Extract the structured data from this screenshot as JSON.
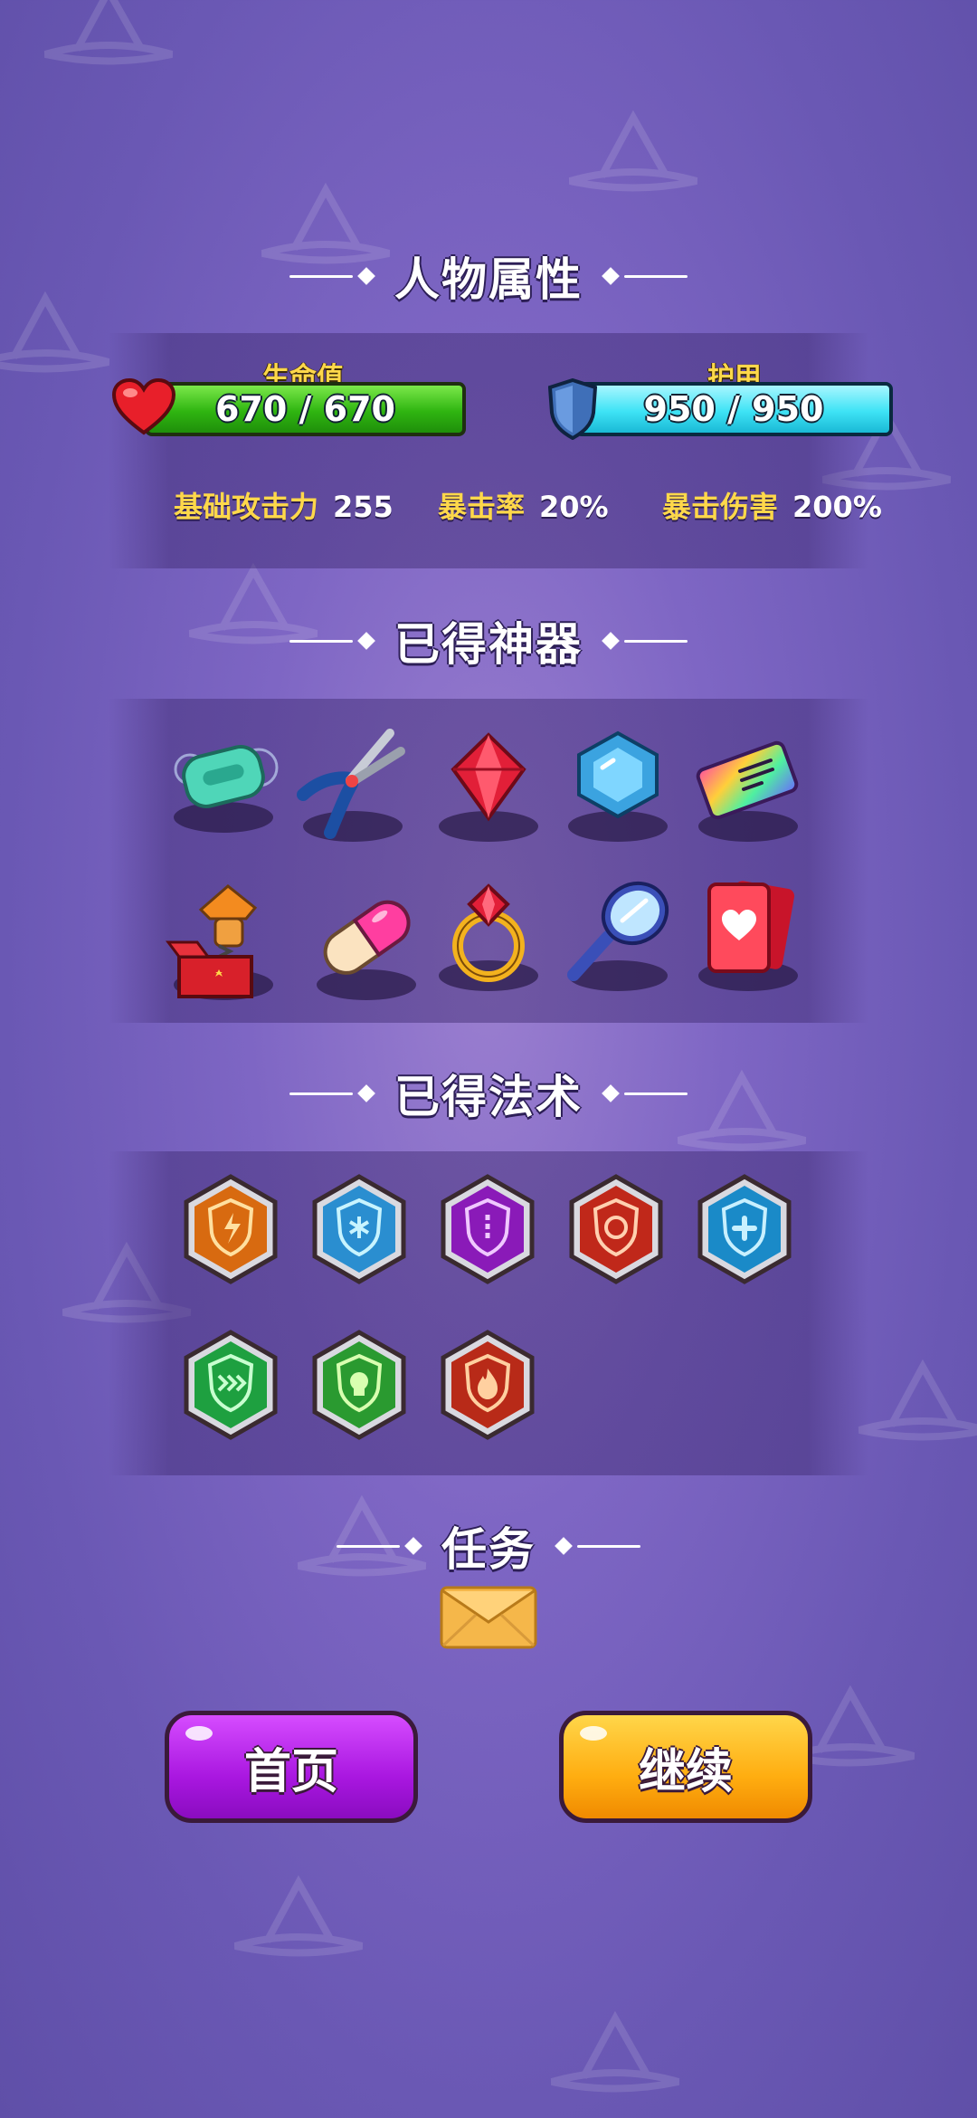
{
  "colors": {
    "background": "#7e66c4",
    "health_fill": "#3fc71f",
    "armor_fill": "#3ee3f5",
    "label_yellow": "#ffd84a",
    "home_button": "#b81be6",
    "continue_button": "#ffad10"
  },
  "sections": {
    "attributes_title": "人物属性",
    "artifacts_title": "已得神器",
    "spells_title": "已得法术",
    "quest_title": "任务"
  },
  "health": {
    "label": "生命值",
    "value_text": "670 / 670",
    "current": 670,
    "max": 670,
    "icon": "heart-icon"
  },
  "armor": {
    "label": "护甲",
    "value_text": "950 / 950",
    "current": 950,
    "max": 950,
    "icon": "shield-icon"
  },
  "stats": [
    {
      "label": "基础攻击力",
      "value": "255"
    },
    {
      "label": "暴击率",
      "value": "20%"
    },
    {
      "label": "暴击伤害",
      "value": "200%"
    }
  ],
  "artifacts": [
    "soap-icon",
    "pliers-icon",
    "red-gem-icon",
    "blue-gem-icon",
    "ticket-icon",
    "jack-in-the-box-icon",
    "pill-icon",
    "ruby-ring-icon",
    "hand-mirror-icon",
    "heart-card-icon"
  ],
  "spells": [
    "lightning-shield-icon",
    "frost-shield-icon",
    "arcane-shield-icon",
    "fire-ring-shield-icon",
    "heal-shield-icon",
    "speed-shield-icon",
    "poison-shield-icon",
    "flame-shield-icon"
  ],
  "quest": {
    "icon": "envelope-icon"
  },
  "buttons": {
    "home": "首页",
    "continue": "继续"
  }
}
